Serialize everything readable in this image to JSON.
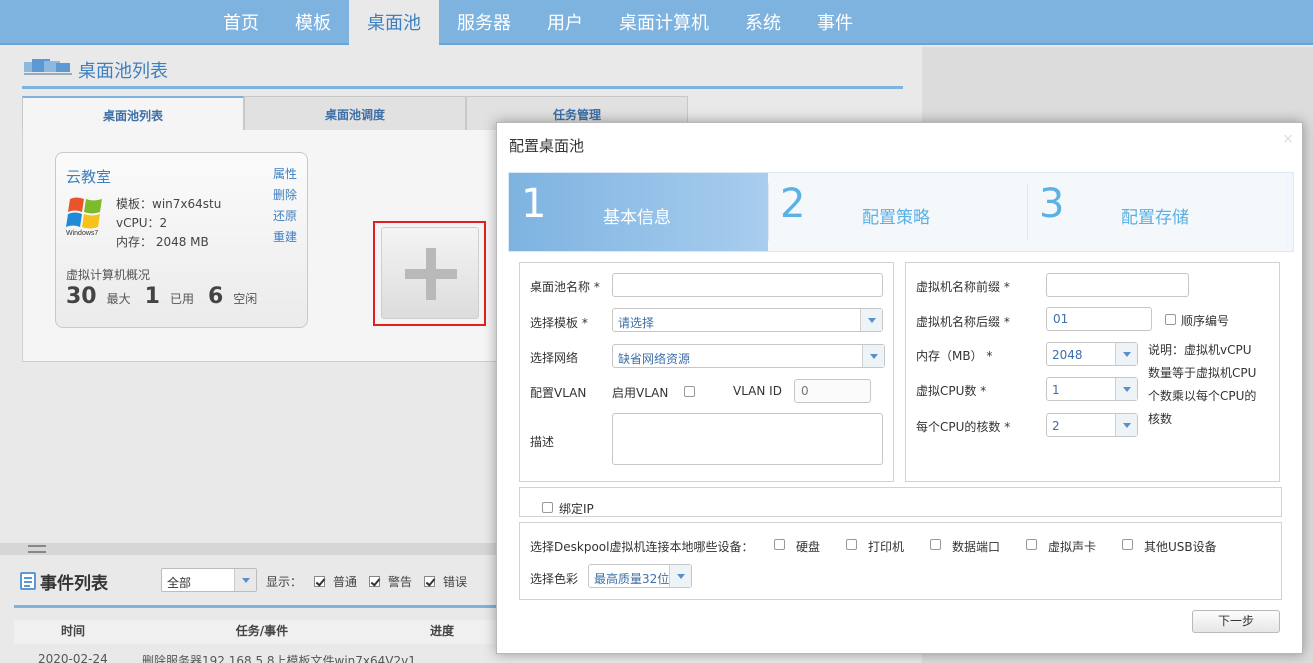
{
  "nav": {
    "items": [
      {
        "label": "首页",
        "active": false
      },
      {
        "label": "模板",
        "active": false
      },
      {
        "label": "桌面池",
        "active": true
      },
      {
        "label": "服务器",
        "active": false
      },
      {
        "label": "用户",
        "active": false
      },
      {
        "label": "桌面计算机",
        "active": false
      },
      {
        "label": "系统",
        "active": false
      },
      {
        "label": "事件",
        "active": false
      }
    ]
  },
  "pool_section": {
    "title": "桌面池列表",
    "tabs": [
      "桌面池列表",
      "桌面池调度",
      "任务管理"
    ]
  },
  "pool_card": {
    "name": "云教室",
    "links": [
      "属性",
      "删除",
      "还原",
      "重建"
    ],
    "logo_text": "Windows7",
    "template": "模板：win7x64stu",
    "vcpu": "vCPU：2",
    "memory": "内存： 2048 MB",
    "overview_title": "虚拟计算机概况",
    "max_value": "30",
    "max_label": "最大",
    "used_value": "1",
    "used_label": "已用",
    "idle_value": "6",
    "idle_label": "空闲"
  },
  "events": {
    "title": "事件列表",
    "filter_value": "全部",
    "show_label": "显示：",
    "filters": [
      {
        "label": "普通",
        "checked": true
      },
      {
        "label": "警告",
        "checked": true
      },
      {
        "label": "错误",
        "checked": true
      }
    ],
    "columns": [
      "时间",
      "任务/事件",
      "进度"
    ],
    "row": {
      "time": "2020-02-24",
      "event": "删除服务器192.168.5.8上模板文件win7x64V2v1"
    }
  },
  "modal": {
    "title": "配置桌面池",
    "close": "×",
    "steps": [
      {
        "num": "1",
        "label": "基本信息",
        "active": true
      },
      {
        "num": "2",
        "label": "配置策略",
        "active": false
      },
      {
        "num": "3",
        "label": "配置存储",
        "active": false
      }
    ],
    "left": {
      "pool_name_label": "桌面池名称 *",
      "template_label": "选择模板 *",
      "template_value": "请选择",
      "network_label": "选择网络",
      "network_value": "缺省网络资源",
      "vlan_label": "配置VLAN",
      "vlan_enable_label": "启用VLAN",
      "vlan_id_label": "VLAN ID",
      "vlan_id_placeholder": "0",
      "desc_label": "描述"
    },
    "right": {
      "prefix_label": "虚拟机名称前缀 *",
      "suffix_label": "虚拟机名称后缀 *",
      "suffix_value": "01",
      "sequential_label": "顺序编号",
      "memory_label": "内存（MB） *",
      "memory_value": "2048",
      "cpu_label": "虚拟CPU数 *",
      "cpu_value": "1",
      "cores_label": "每个CPU的核数 *",
      "cores_value": "2",
      "note": "说明：虚拟机vCPU数量等于虚拟机CPU个数乘以每个CPU的核数"
    },
    "bind_ip_label": "绑定IP",
    "devices_label": "选择Deskpool虚拟机连接本地哪些设备：",
    "devices": [
      "硬盘",
      "打印机",
      "数据端口",
      "虚拟声卡",
      "其他USB设备"
    ],
    "color_label": "选择色彩",
    "color_value": "最高质量32位",
    "next_button": "下一步"
  }
}
